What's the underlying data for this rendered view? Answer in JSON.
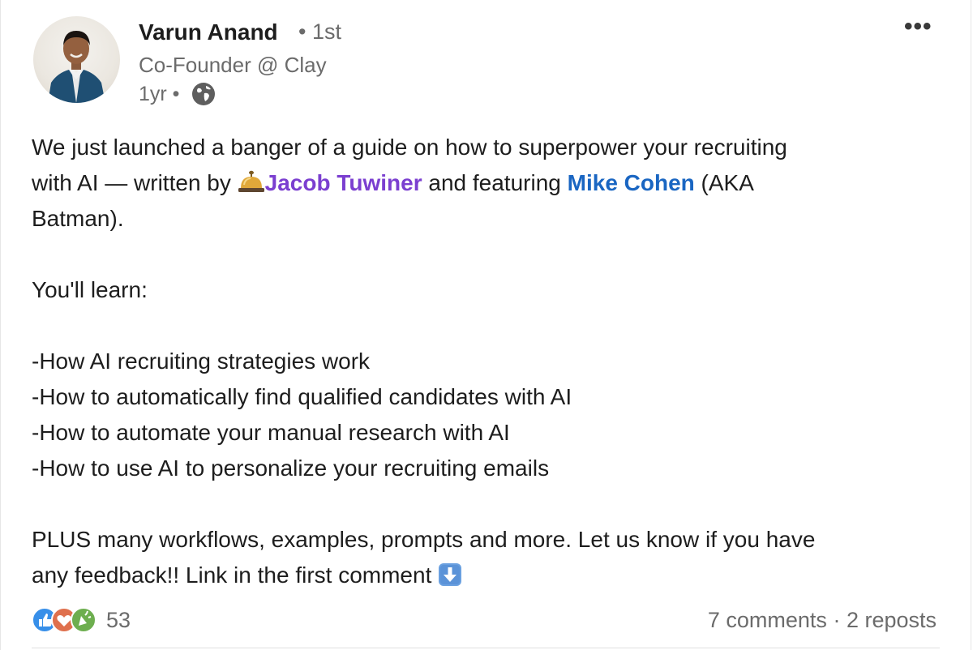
{
  "author": {
    "name": "Varun Anand",
    "degree": "• 1st",
    "headline": "Co-Founder @ Clay",
    "time": "1yr •",
    "visibility_icon": "globe-icon"
  },
  "menu": {
    "more_label": "•••"
  },
  "post": {
    "line1": "We just launched a banger of a guide on how to superpower your recruiting",
    "line2_pre": "with AI — written by ",
    "mention1": "Jacob Tuwiner",
    "line2_mid": " and featuring ",
    "mention2": "Mike Cohen",
    "line2_post": " (AKA",
    "line3": "Batman).",
    "line4": "",
    "line5": "You'll learn:",
    "line6": "",
    "line7": "-How AI recruiting strategies work",
    "line8": "-How to automatically find qualified candidates with AI",
    "line9": "-How to automate your manual research with AI",
    "line10": "-How to use AI to personalize your recruiting emails",
    "line11": "",
    "line12": "PLUS many workflows, examples, prompts and more. Let us know if you have",
    "line13": "any feedback!! Link in the first comment "
  },
  "social": {
    "reaction_count": "53",
    "comments": "7 comments",
    "separator": " · ",
    "reposts": "2 reposts"
  },
  "colors": {
    "mention_purple": "#7b3fd0",
    "mention_blue": "#1a66c2",
    "muted_text": "#6b6b6b"
  }
}
